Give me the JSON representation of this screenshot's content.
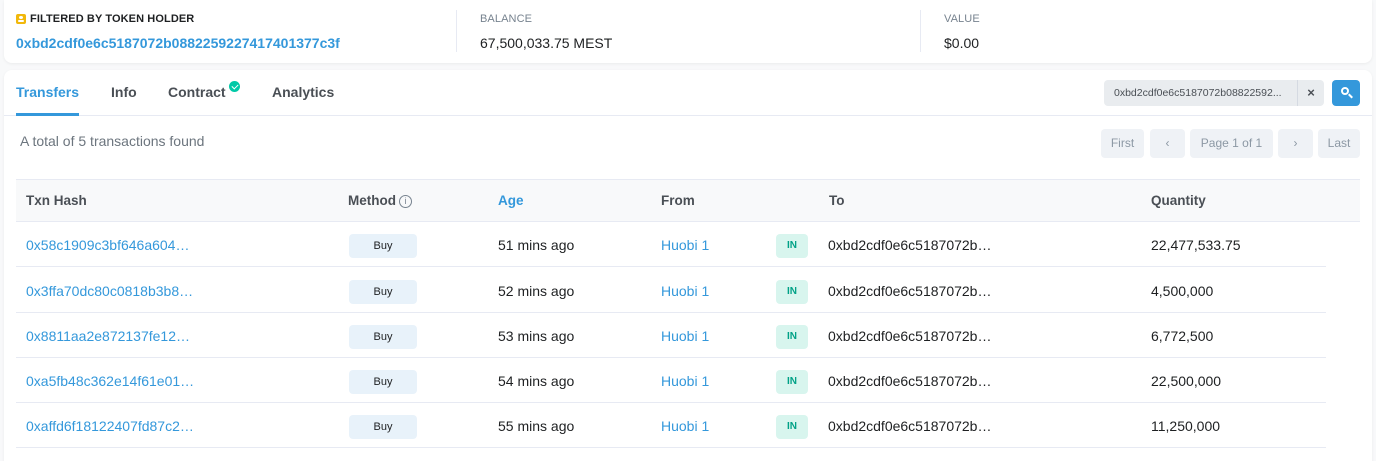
{
  "summary": {
    "holder_label": "FILTERED BY TOKEN HOLDER",
    "holder_address": "0xbd2cdf0e6c5187072b088225922741740137 7c3f",
    "balance_label": "BALANCE",
    "balance_value": "67,500,033.75 MEST",
    "value_label": "VALUE",
    "value_value": "$0.00"
  },
  "tabs": [
    {
      "label": "Transfers",
      "active": true
    },
    {
      "label": "Info"
    },
    {
      "label": "Contract",
      "verified": true
    },
    {
      "label": "Analytics"
    }
  ],
  "filter": {
    "value": "0xbd2cdf0e6c5187072b08822592...",
    "clear_label": "×"
  },
  "total_text": "A total of 5 transactions found",
  "pagination": {
    "first": "First",
    "prev": "‹",
    "page": "Page 1 of 1",
    "next": "›",
    "last": "Last"
  },
  "table": {
    "headers": {
      "hash": "Txn Hash",
      "method": "Method",
      "age": "Age",
      "from": "From",
      "to": "To",
      "quantity": "Quantity"
    },
    "rows": [
      {
        "hash": "0x58c1909c3bf646a604…",
        "method": "Buy",
        "age": "51 mins ago",
        "from": "Huobi 1",
        "direction": "IN",
        "to": "0xbd2cdf0e6c5187072b…",
        "quantity": "22,477,533.75"
      },
      {
        "hash": "0x3ffa70dc80c0818b3b8…",
        "method": "Buy",
        "age": "52 mins ago",
        "from": "Huobi 1",
        "direction": "IN",
        "to": "0xbd2cdf0e6c5187072b…",
        "quantity": "4,500,000"
      },
      {
        "hash": "0x8811aa2e872137fe12…",
        "method": "Buy",
        "age": "53 mins ago",
        "from": "Huobi 1",
        "direction": "IN",
        "to": "0xbd2cdf0e6c5187072b…",
        "quantity": "6,772,500"
      },
      {
        "hash": "0xa5fb48c362e14f61e01…",
        "method": "Buy",
        "age": "54 mins ago",
        "from": "Huobi 1",
        "direction": "IN",
        "to": "0xbd2cdf0e6c5187072b…",
        "quantity": "22,500,000"
      },
      {
        "hash": "0xaffd6f18122407fd87c2…",
        "method": "Buy",
        "age": "55 mins ago",
        "from": "Huobi 1",
        "direction": "IN",
        "to": "0xbd2cdf0e6c5187072b…",
        "quantity": "11,250,000"
      }
    ]
  },
  "icons": {
    "holder": "token-holder-icon",
    "verified": "check-circle-icon",
    "search": "search-icon",
    "info": "info-circle-icon"
  },
  "colors": {
    "accent": "#3498db",
    "in_badge_bg": "#d8f5ee",
    "in_badge_text": "#00a186",
    "verified": "#00c9a7"
  }
}
